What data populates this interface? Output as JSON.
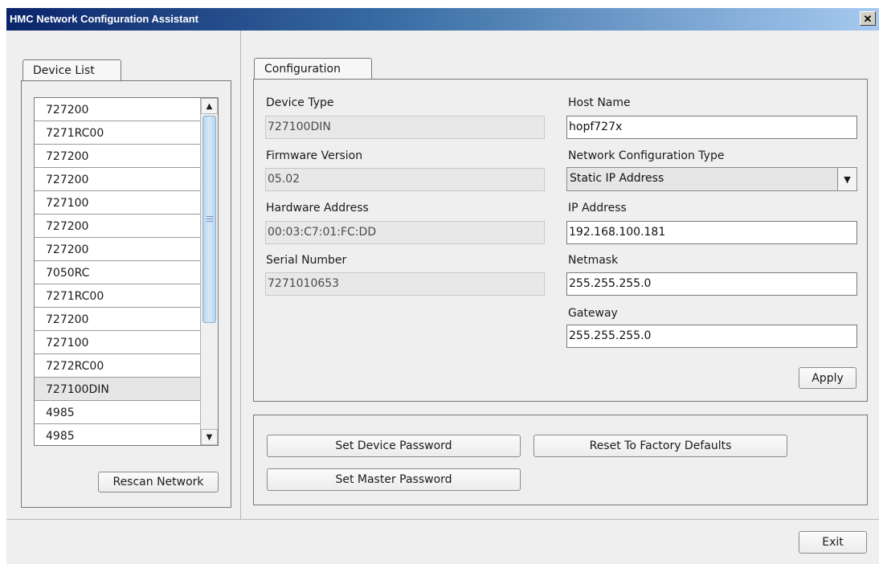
{
  "window": {
    "title": "HMC Network Configuration Assistant",
    "close_glyph": "✕"
  },
  "left": {
    "tab_label": "Device List",
    "devices": [
      "727200",
      "7271RC00",
      "727200",
      "727200",
      "727100",
      "727200",
      "727200",
      "7050RC",
      "7271RC00",
      "727200",
      "727100",
      "7272RC00",
      "727100DIN",
      "4985",
      "4985"
    ],
    "selected_index": 12,
    "rescan_label": "Rescan Network",
    "scroll_up_icon": "triangle-up-icon",
    "scroll_down_icon": "triangle-down-icon"
  },
  "config": {
    "tab_label": "Configuration",
    "device_type_label": "Device Type",
    "device_type_value": "727100DIN",
    "firmware_label": "Firmware Version",
    "firmware_value": "05.02",
    "hardware_label": "Hardware Address",
    "hardware_value": "00:03:C7:01:FC:DD",
    "serial_label": "Serial Number",
    "serial_value": "7271010653",
    "host_label": "Host Name",
    "host_value": "hopf727x",
    "nettype_label": "Network Configuration Type",
    "nettype_value": "Static IP Address",
    "ip_label": "IP Address",
    "ip_value": "192.168.100.181",
    "netmask_label": "Netmask",
    "netmask_value": "255.255.255.0",
    "gateway_label": "Gateway",
    "gateway_value": "255.255.255.0",
    "apply_label": "Apply"
  },
  "actions": {
    "set_device_password": "Set Device Password",
    "reset_factory": "Reset To Factory Defaults",
    "set_master_password": "Set Master Password"
  },
  "footer": {
    "exit_label": "Exit"
  }
}
